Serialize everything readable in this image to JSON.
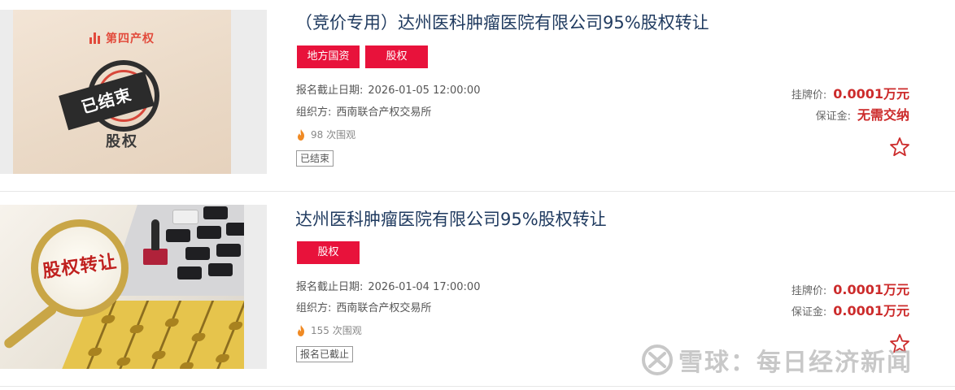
{
  "listings": [
    {
      "title": "（竞价专用）达州医科肿瘤医院有限公司95%股权转让",
      "tags": [
        "地方国资",
        "股权"
      ],
      "deadline_label": "报名截止日期:",
      "deadline": "2026-01-05 12:00:00",
      "organizer_label": "组织方:",
      "organizer": "西南联合产权交易所",
      "views": "98",
      "views_suffix": "次围观",
      "status": "已结束",
      "listing_price_label": "挂牌价:",
      "listing_price": "0.0001万元",
      "deposit_label": "保证金:",
      "deposit": "无需交纳",
      "thumbnail": {
        "logo_text": "第四产权",
        "stamp_text": "已结束",
        "caption": "股权"
      }
    },
    {
      "title": "达州医科肿瘤医院有限公司95%股权转让",
      "tags": [
        "股权"
      ],
      "deadline_label": "报名截止日期:",
      "deadline": "2026-01-04 17:00:00",
      "organizer_label": "组织方:",
      "organizer": "西南联合产权交易所",
      "views": "155",
      "views_suffix": "次围观",
      "status": "报名已截止",
      "listing_price_label": "挂牌价:",
      "listing_price": "0.0001万元",
      "deposit_label": "保证金:",
      "deposit": "0.0001万元",
      "thumbnail": {
        "magnifier_text": "股权转让"
      }
    }
  ],
  "watermark": {
    "text": "雪球：每日经济新闻"
  },
  "colors": {
    "tag_red": "#e8123b",
    "price_red": "#cc2b2b",
    "title_blue": "#1f3a5f"
  },
  "icons": [
    "flame-icon",
    "star-icon",
    "xueqiu-logo-icon"
  ]
}
